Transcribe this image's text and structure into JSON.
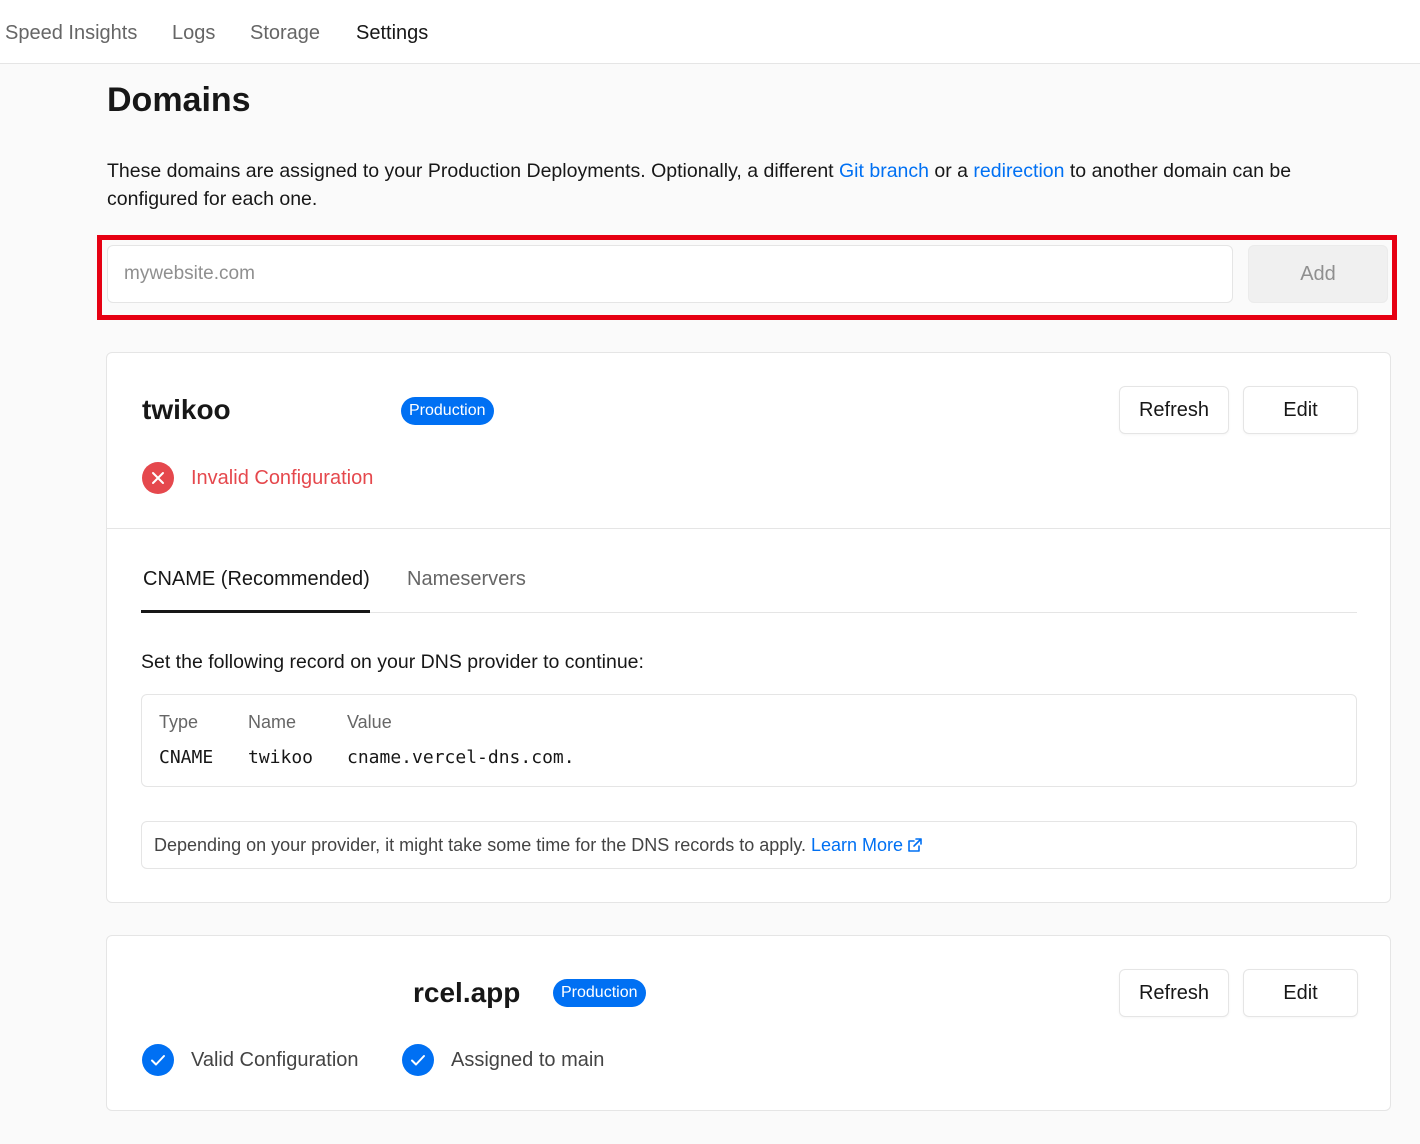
{
  "nav": {
    "tabs": [
      {
        "label": "Speed Insights",
        "active": false
      },
      {
        "label": "Logs",
        "active": false
      },
      {
        "label": "Storage",
        "active": false
      },
      {
        "label": "Settings",
        "active": true
      }
    ]
  },
  "page": {
    "title": "Domains",
    "intro_before": "These domains are assigned to your Production Deployments. Optionally, a different ",
    "intro_link1": "Git branch",
    "intro_middle": " or a ",
    "intro_link2": "redirection",
    "intro_after": " to another domain can be configured for each one."
  },
  "add_domain": {
    "placeholder": "mywebsite.com",
    "value": "",
    "button_label": "Add"
  },
  "domains": [
    {
      "name": "twikoo",
      "badge": "Production",
      "refresh_label": "Refresh",
      "edit_label": "Edit",
      "status": "Invalid Configuration",
      "tabs": [
        "CNAME (Recommended)",
        "Nameservers"
      ],
      "active_tab": 0,
      "instruction": "Set the following record on your DNS provider to continue:",
      "record": {
        "headers": [
          "Type",
          "Name",
          "Value"
        ],
        "type": "CNAME",
        "name": "twikoo",
        "value": "cname.vercel-dns.com."
      },
      "note": "Depending on your provider, it might take some time for the DNS records to apply.",
      "note_link": "Learn More"
    },
    {
      "name": "rcel.app",
      "badge": "Production",
      "refresh_label": "Refresh",
      "edit_label": "Edit",
      "statuses": [
        "Valid Configuration",
        "Assigned to main"
      ]
    }
  ],
  "colors": {
    "accent": "#0070f3",
    "error": "#e5484d",
    "highlight": "#e60012"
  },
  "icons": {
    "error": "x-circle-icon",
    "valid": "check-circle-icon",
    "external": "external-link-icon"
  }
}
